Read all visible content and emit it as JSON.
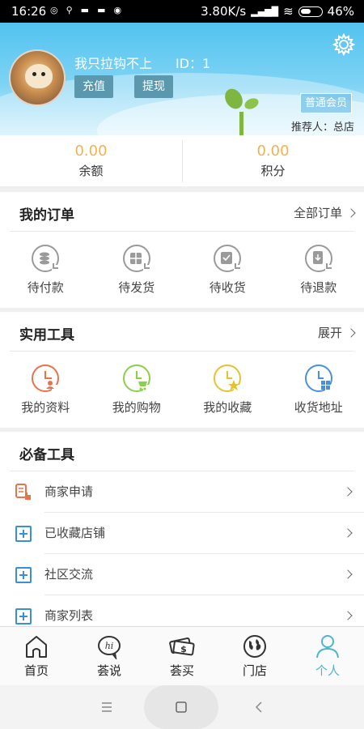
{
  "status_bar": {
    "time": "16:26",
    "speed": "3.80K/s",
    "battery": "46%"
  },
  "header": {
    "username": "我只拉钩不上",
    "user_id": "ID：1",
    "recharge_label": "充值",
    "withdraw_label": "提现",
    "member_level": "普通会员",
    "referrer": "推荐人：总店"
  },
  "balance": {
    "balance_value": "0.00",
    "balance_label": "余额",
    "points_value": "0.00",
    "points_label": "积分"
  },
  "orders": {
    "title": "我的订单",
    "more_label": "全部订单",
    "items": [
      {
        "label": "待付款",
        "icon": "coins-icon"
      },
      {
        "label": "待发货",
        "icon": "box-icon"
      },
      {
        "label": "待收货",
        "icon": "check-box-icon"
      },
      {
        "label": "待退款",
        "icon": "refund-icon"
      }
    ]
  },
  "tools": {
    "title": "实用工具",
    "more_label": "展开",
    "items": [
      {
        "label": "我的资料",
        "icon": "profile-icon",
        "color": "#e8734a"
      },
      {
        "label": "我的购物",
        "icon": "cart-icon",
        "color": "#8bcf4a"
      },
      {
        "label": "我的收藏",
        "icon": "star-icon",
        "color": "#e6c232"
      },
      {
        "label": "收货地址",
        "icon": "address-icon",
        "color": "#4a90d9"
      }
    ]
  },
  "essentials": {
    "title": "必备工具",
    "items": [
      {
        "label": "商家申请",
        "icon": "merchant-apply-icon"
      },
      {
        "label": "已收藏店铺",
        "icon": "saved-shop-icon"
      },
      {
        "label": "社区交流",
        "icon": "community-icon"
      },
      {
        "label": "商家列表",
        "icon": "merchant-list-icon"
      }
    ]
  },
  "tabbar": {
    "items": [
      {
        "label": "首页",
        "icon": "home-icon"
      },
      {
        "label": "荟说",
        "icon": "chat-icon"
      },
      {
        "label": "荟买",
        "icon": "money-icon"
      },
      {
        "label": "门店",
        "icon": "globe-icon"
      },
      {
        "label": "个人",
        "icon": "person-icon"
      }
    ],
    "active_color": "#4fb6c9"
  }
}
